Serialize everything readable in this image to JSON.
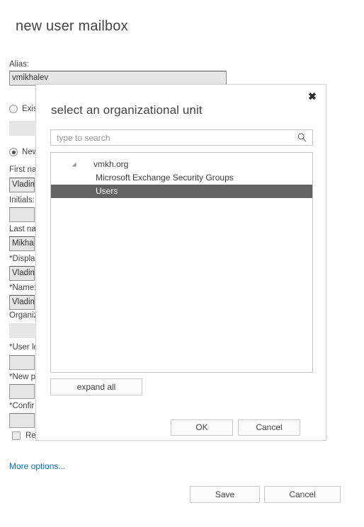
{
  "form": {
    "title": "new user mailbox",
    "alias": {
      "label": "Alias:",
      "value": "vmikhalev"
    },
    "existing_user": {
      "label": "Exis"
    },
    "new_user": {
      "label": "New"
    },
    "fields": [
      {
        "label": "First na",
        "value": "Vladim"
      },
      {
        "label": "Initials:",
        "value": ""
      },
      {
        "label": "Last na",
        "value": "Mikhal"
      },
      {
        "label": "*Displa",
        "value": "Vladim"
      },
      {
        "label": "*Name:",
        "value": "Vladim"
      },
      {
        "label": "Organiz",
        "value": ""
      },
      {
        "label": "*User lo",
        "value": ""
      },
      {
        "label": "*New p",
        "value": ""
      },
      {
        "label": "*Confir",
        "value": ""
      }
    ],
    "require_checkbox_label": "Re",
    "more_options": "More options...",
    "save_label": "Save",
    "cancel_label": "Cancel"
  },
  "dialog": {
    "title": "select an organizational unit",
    "close_label": "✖",
    "search": {
      "placeholder": "type to search",
      "value": ""
    },
    "tree": [
      {
        "label": "vmkh.org",
        "level": 0,
        "expanded": true,
        "selected": false
      },
      {
        "label": "Microsoft Exchange Security Groups",
        "level": 1,
        "expanded": false,
        "selected": false
      },
      {
        "label": "Users",
        "level": 1,
        "expanded": false,
        "selected": true
      }
    ],
    "expand_all_label": "expand all",
    "ok_label": "OK",
    "cancel_label": "Cancel"
  },
  "colors": {
    "selection": "#636363",
    "link": "#0a6ebd",
    "input_bg": "#e6e6e6",
    "border": "#c3c3c3"
  }
}
